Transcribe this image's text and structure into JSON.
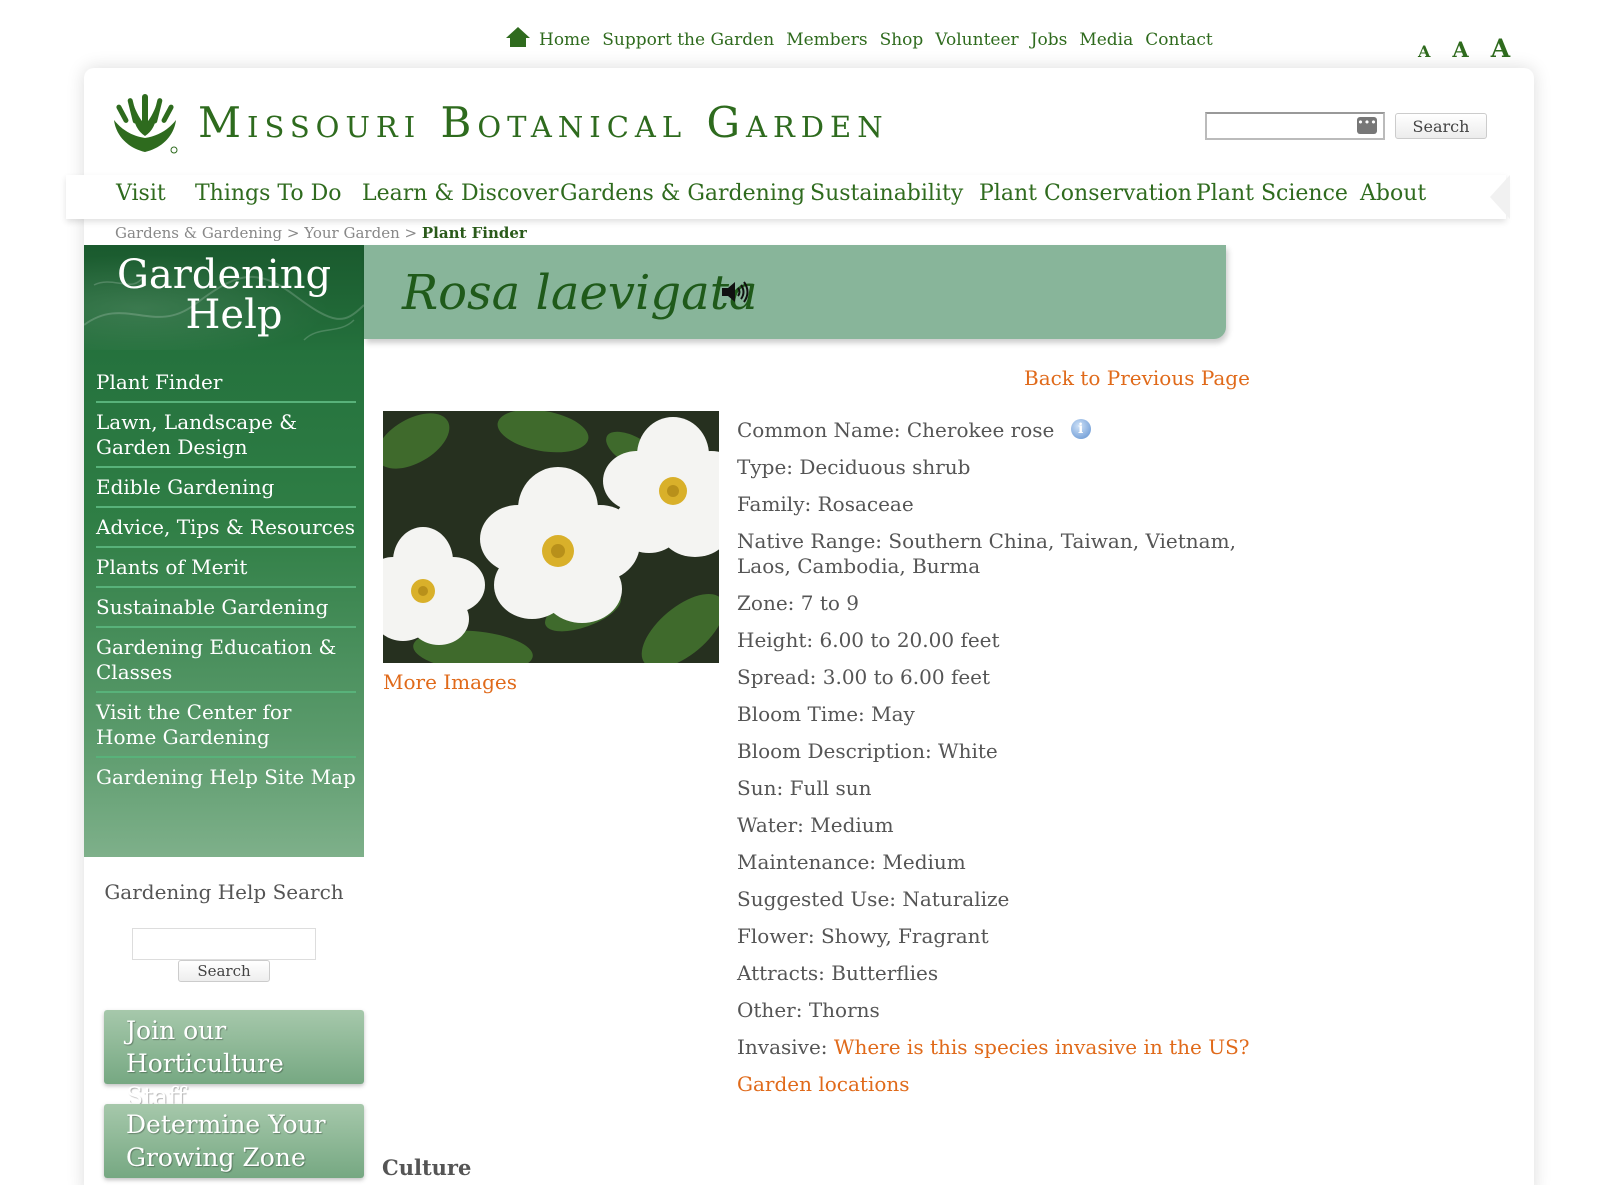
{
  "utility_nav": {
    "home_icon": "home-icon",
    "links": [
      "Home",
      "Support the Garden",
      "Members",
      "Shop",
      "Volunteer",
      "Jobs",
      "Media",
      "Contact"
    ],
    "font_sizes": [
      "A",
      "A",
      "A"
    ]
  },
  "header": {
    "logo_text": "Missouri Botanical Garden",
    "search_button": "Search"
  },
  "main_nav": [
    "Visit",
    "Things To Do",
    "Learn & Discover",
    "Gardens & Gardening",
    "Sustainability",
    "Plant Conservation",
    "Plant Science",
    "About"
  ],
  "breadcrumb": {
    "items": [
      "Gardens & Gardening",
      "Your Garden"
    ],
    "separator": ">",
    "current": "Plant Finder"
  },
  "sidebar": {
    "title_line1": "Gardening",
    "title_line2": "Help",
    "items": [
      "Plant Finder",
      "Lawn, Landscape & Garden Design",
      "Edible Gardening",
      "Advice, Tips & Resources",
      "Plants of Merit",
      "Sustainable Gardening",
      "Gardening Education & Classes",
      "Visit the Center for Home Gardening",
      "Gardening Help Site Map"
    ],
    "search_label": "Gardening Help Search",
    "search_button": "Search",
    "promos": [
      "Join our Horticulture Staff",
      "Determine Your Growing Zone"
    ]
  },
  "plant": {
    "title": "Rosa laevigata",
    "back_link": "Back to Previous Page",
    "more_images": "More Images",
    "attributes": [
      {
        "label": "Common Name:",
        "value": "Cherokee rose"
      },
      {
        "label": "Type:",
        "value": "Deciduous shrub"
      },
      {
        "label": "Family:",
        "value": "Rosaceae"
      },
      {
        "label": "Native Range:",
        "value": "Southern China, Taiwan, Vietnam, Laos, Cambodia, Burma"
      },
      {
        "label": "Zone:",
        "value": "7 to 9"
      },
      {
        "label": "Height:",
        "value": "6.00 to 20.00 feet"
      },
      {
        "label": "Spread:",
        "value": "3.00 to 6.00 feet"
      },
      {
        "label": "Bloom Time:",
        "value": "May"
      },
      {
        "label": "Bloom Description:",
        "value": "White"
      },
      {
        "label": "Sun:",
        "value": "Full sun"
      },
      {
        "label": "Water:",
        "value": "Medium"
      },
      {
        "label": "Maintenance:",
        "value": "Medium"
      },
      {
        "label": "Suggested Use:",
        "value": "Naturalize"
      },
      {
        "label": "Flower:",
        "value": "Showy, Fragrant"
      },
      {
        "label": "Attracts:",
        "value": "Butterflies"
      },
      {
        "label": "Other:",
        "value": "Thorns"
      }
    ],
    "invasive_label": "Invasive:",
    "invasive_link": "Where is this species invasive in the US?",
    "garden_locations": "Garden locations",
    "culture_heading": "Culture"
  },
  "colors": {
    "brand_green": "#2f6b1e",
    "link_orange": "#e06a1a",
    "title_band": "#88b59a",
    "sidebar_green": "#1e6a38"
  }
}
